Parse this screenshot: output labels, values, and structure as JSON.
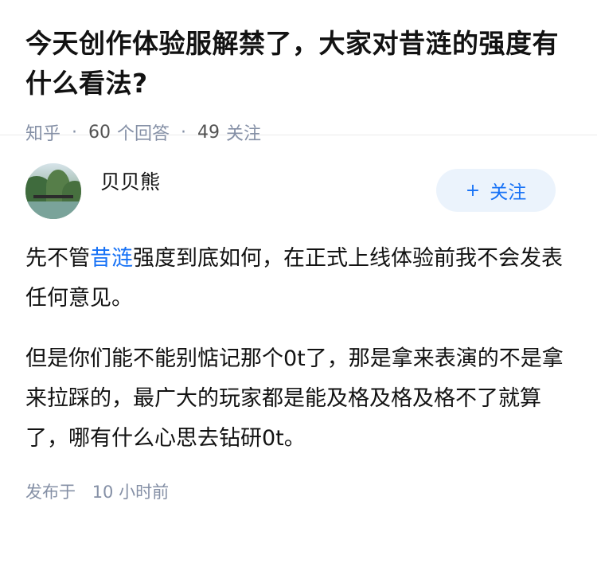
{
  "question": {
    "title": "今天创作体验服解禁了，大家对昔涟的强度有什么看法?",
    "source": "知乎",
    "answer_count": "60",
    "answer_label": "个回答",
    "follower_count": "49",
    "follower_label": "关注"
  },
  "answer": {
    "author": "贝贝熊",
    "follow_button": "+ 关注",
    "follow_plus": "+",
    "follow_label": "关注",
    "paragraph1_pre": "先不管",
    "paragraph1_link": "昔涟",
    "paragraph1_post": "强度到底如何，在正式上线体验前我不会发表任何意见。",
    "paragraph2": "但是你们能不能别惦记那个0t了，那是拿来表演的不是拿来拉踩的，最广大的玩家都是能及格及格及格不了就算了，哪有什么心思去钻研0t。",
    "published_label": "发布于",
    "published_time": "10 小时前"
  },
  "colors": {
    "accent": "#1772f6",
    "muted": "#8590a6",
    "follow_bg": "#ebf3fc"
  },
  "icons": {
    "avatar": "landscape-avatar"
  }
}
